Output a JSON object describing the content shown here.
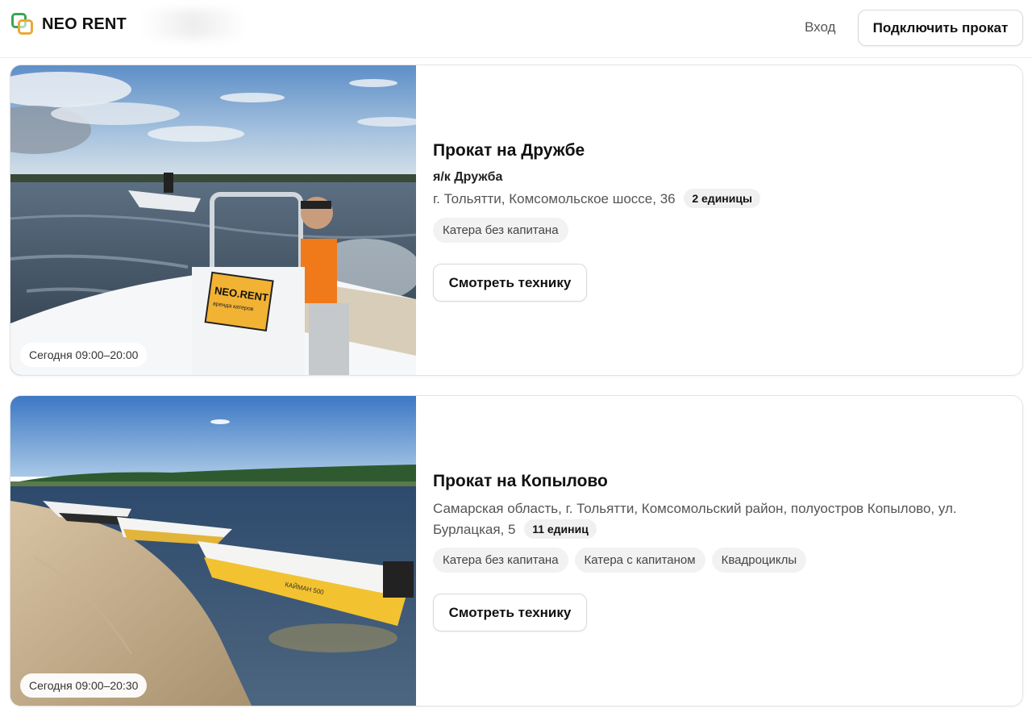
{
  "header": {
    "brand": "NEO RENT",
    "login_label": "Вход",
    "connect_label": "Подключить прокат"
  },
  "rentals": [
    {
      "title": "Прокат на Дружбе",
      "subtitle": "я/к Дружба",
      "address": "г. Тольятти, Комсомольское шоссе, 36",
      "units": "2 единицы",
      "tags": [
        "Катера без капитана"
      ],
      "hours": "Сегодня 09:00–20:00",
      "button_label": "Смотреть технику",
      "photo_sign": "NEO.RENT",
      "photo_sign_sub": "аренда катеров"
    },
    {
      "title": "Прокат на Копылово",
      "address": "Самарская область, г. Тольятти, Комсомольский район, полуостров Копылово, ул. Бурлацкая, 5",
      "units": "11 единиц",
      "tags": [
        "Катера без капитана",
        "Катера с капитаном",
        "Квадроциклы"
      ],
      "hours": "Сегодня 09:00–20:30",
      "button_label": "Смотреть технику",
      "photo_boat_text": "КАЙМАН 500"
    }
  ],
  "colors": {
    "logo_green": "#3aa655",
    "logo_orange": "#e8a93a",
    "life_vest": "#f07a1a",
    "boat_yellow": "#f2c230"
  }
}
